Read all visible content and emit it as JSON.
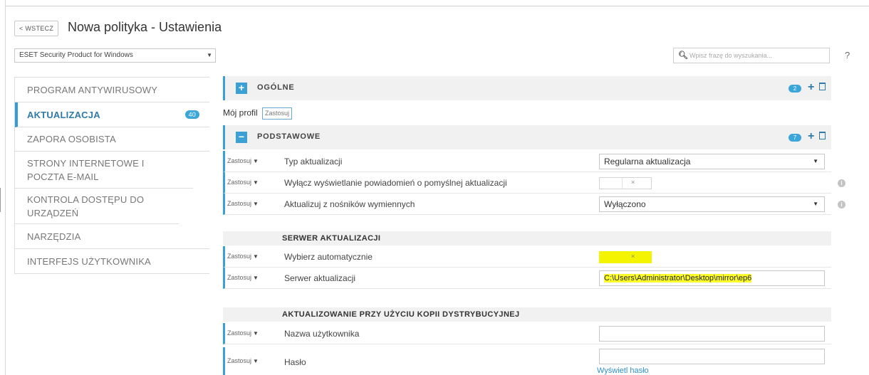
{
  "header": {
    "back_label": "< WSTECZ",
    "title": "Nowa polityka - Ustawienia"
  },
  "product_select": {
    "value": "ESET Security Product for Windows"
  },
  "search": {
    "placeholder": "Wpisz frazę do wyszukania..."
  },
  "help_label": "?",
  "sidebar": {
    "items": [
      {
        "label": "PROGRAM ANTYWIRUSOWY"
      },
      {
        "label": "AKTUALIZACJA",
        "badge": "40"
      },
      {
        "label": "ZAPORA OSOBISTA"
      },
      {
        "label": "STRONY INTERNETOWE I POCZTA E-MAIL"
      },
      {
        "label": "KONTROLA DOSTĘPU DO URZĄDZEŃ"
      },
      {
        "label": "NARZĘDZIA"
      },
      {
        "label": "INTERFEJS UŻYTKOWNIKA"
      }
    ]
  },
  "sections": {
    "general": {
      "toggle": "+",
      "label": "OGÓLNE",
      "count": "2"
    },
    "basic": {
      "toggle": "−",
      "label": "PODSTAWOWE",
      "count": "7"
    }
  },
  "profile": {
    "label": "Mój profil",
    "apply": "Zastosuj"
  },
  "apply_label": "Zastosuj",
  "rows": {
    "update_type": {
      "label": "Typ aktualizacji",
      "value": "Regularna aktualizacja"
    },
    "disable_notif": {
      "label": "Wyłącz wyświetlanie powiadomień o pomyślnej aktualizacji",
      "value": "×"
    },
    "removable": {
      "label": "Aktualizuj z nośników wymiennych",
      "value": "Wyłączono"
    },
    "auto_choose": {
      "label": "Wybierz automatycznie",
      "value": "×"
    },
    "update_server": {
      "label": "Serwer aktualizacji",
      "value": "C:\\Users\\Administrator\\Desktop\\mirror\\ep6"
    },
    "username": {
      "label": "Nazwa użytkownika",
      "value": ""
    },
    "password": {
      "label": "Hasło",
      "value": ""
    }
  },
  "subheads": {
    "server": "SERWER AKTUALIZACJI",
    "mirror": "AKTUALIZOWANIE PRZY UŻYCIU KOPII DYSTRYBUCYJNEJ"
  },
  "show_password": "Wyświetl hasło",
  "colors": {
    "accent": "#3aa0d5",
    "highlight": "#ffff2a"
  }
}
